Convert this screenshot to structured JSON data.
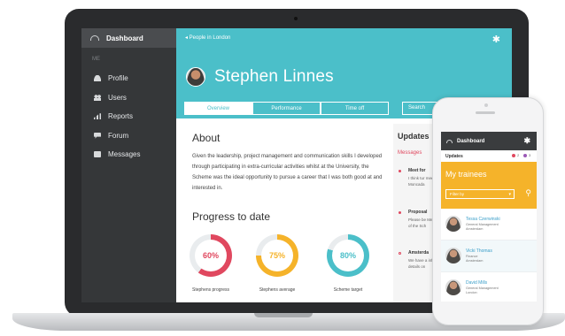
{
  "sidebar": {
    "dashboard": "Dashboard",
    "section": "ME",
    "items": [
      {
        "label": "Profile",
        "icon": "profile-icon"
      },
      {
        "label": "Users",
        "icon": "users-icon"
      },
      {
        "label": "Reports",
        "icon": "reports-icon"
      },
      {
        "label": "Forum",
        "icon": "forum-icon"
      },
      {
        "label": "Messages",
        "icon": "messages-icon"
      }
    ]
  },
  "header": {
    "breadcrumb": "◂ People in London",
    "name": "Stephen Linnes",
    "tabs": [
      "Overview",
      "Performance",
      "Time off"
    ],
    "search_placeholder": "Search"
  },
  "about": {
    "heading": "About",
    "text": "Given the leadership, project management and communication skills I developed through participating in extra-curricular activities whilst at the University, the Scheme was the ideal opportunity to pursue a career that I was both good at and interested in."
  },
  "progress": {
    "heading": "Progress to date",
    "rings": [
      {
        "value": "60%",
        "fraction": 0.6,
        "label": "Stephens progress",
        "color": "#e0485f"
      },
      {
        "value": "75%",
        "fraction": 0.75,
        "label": "Stephens average",
        "color": "#f5b32a"
      },
      {
        "value": "80%",
        "fraction": 0.8,
        "label": "Scheme target",
        "color": "#4bbfc9"
      }
    ]
  },
  "updates": {
    "heading": "Updates",
    "tab": "Messages",
    "items": [
      {
        "title": "Meet for ",
        "body": "I think tur meet and Moncada"
      },
      {
        "title": "Proposal",
        "body": "Please be Meeting a of the Sch"
      },
      {
        "title": "Amsterda",
        "body": "We have a informati details on"
      }
    ]
  },
  "phone": {
    "dashboard": "Dashboard",
    "updates": "Updates",
    "badge1": "2",
    "badge2": "3",
    "title": "My trainees",
    "filter": "Filter by",
    "trainees": [
      {
        "name": "Tessa Czerwinski",
        "role": "General Management",
        "city": "Amsterdam"
      },
      {
        "name": "Vicki Thomas",
        "role": "Finance",
        "city": "Amsterdam"
      },
      {
        "name": "David Mills",
        "role": "General Management",
        "city": "London"
      }
    ]
  },
  "colors": {
    "teal": "#4bbfc9",
    "red": "#e0485f",
    "yellow": "#f5b32a",
    "purple": "#9b59b6"
  }
}
